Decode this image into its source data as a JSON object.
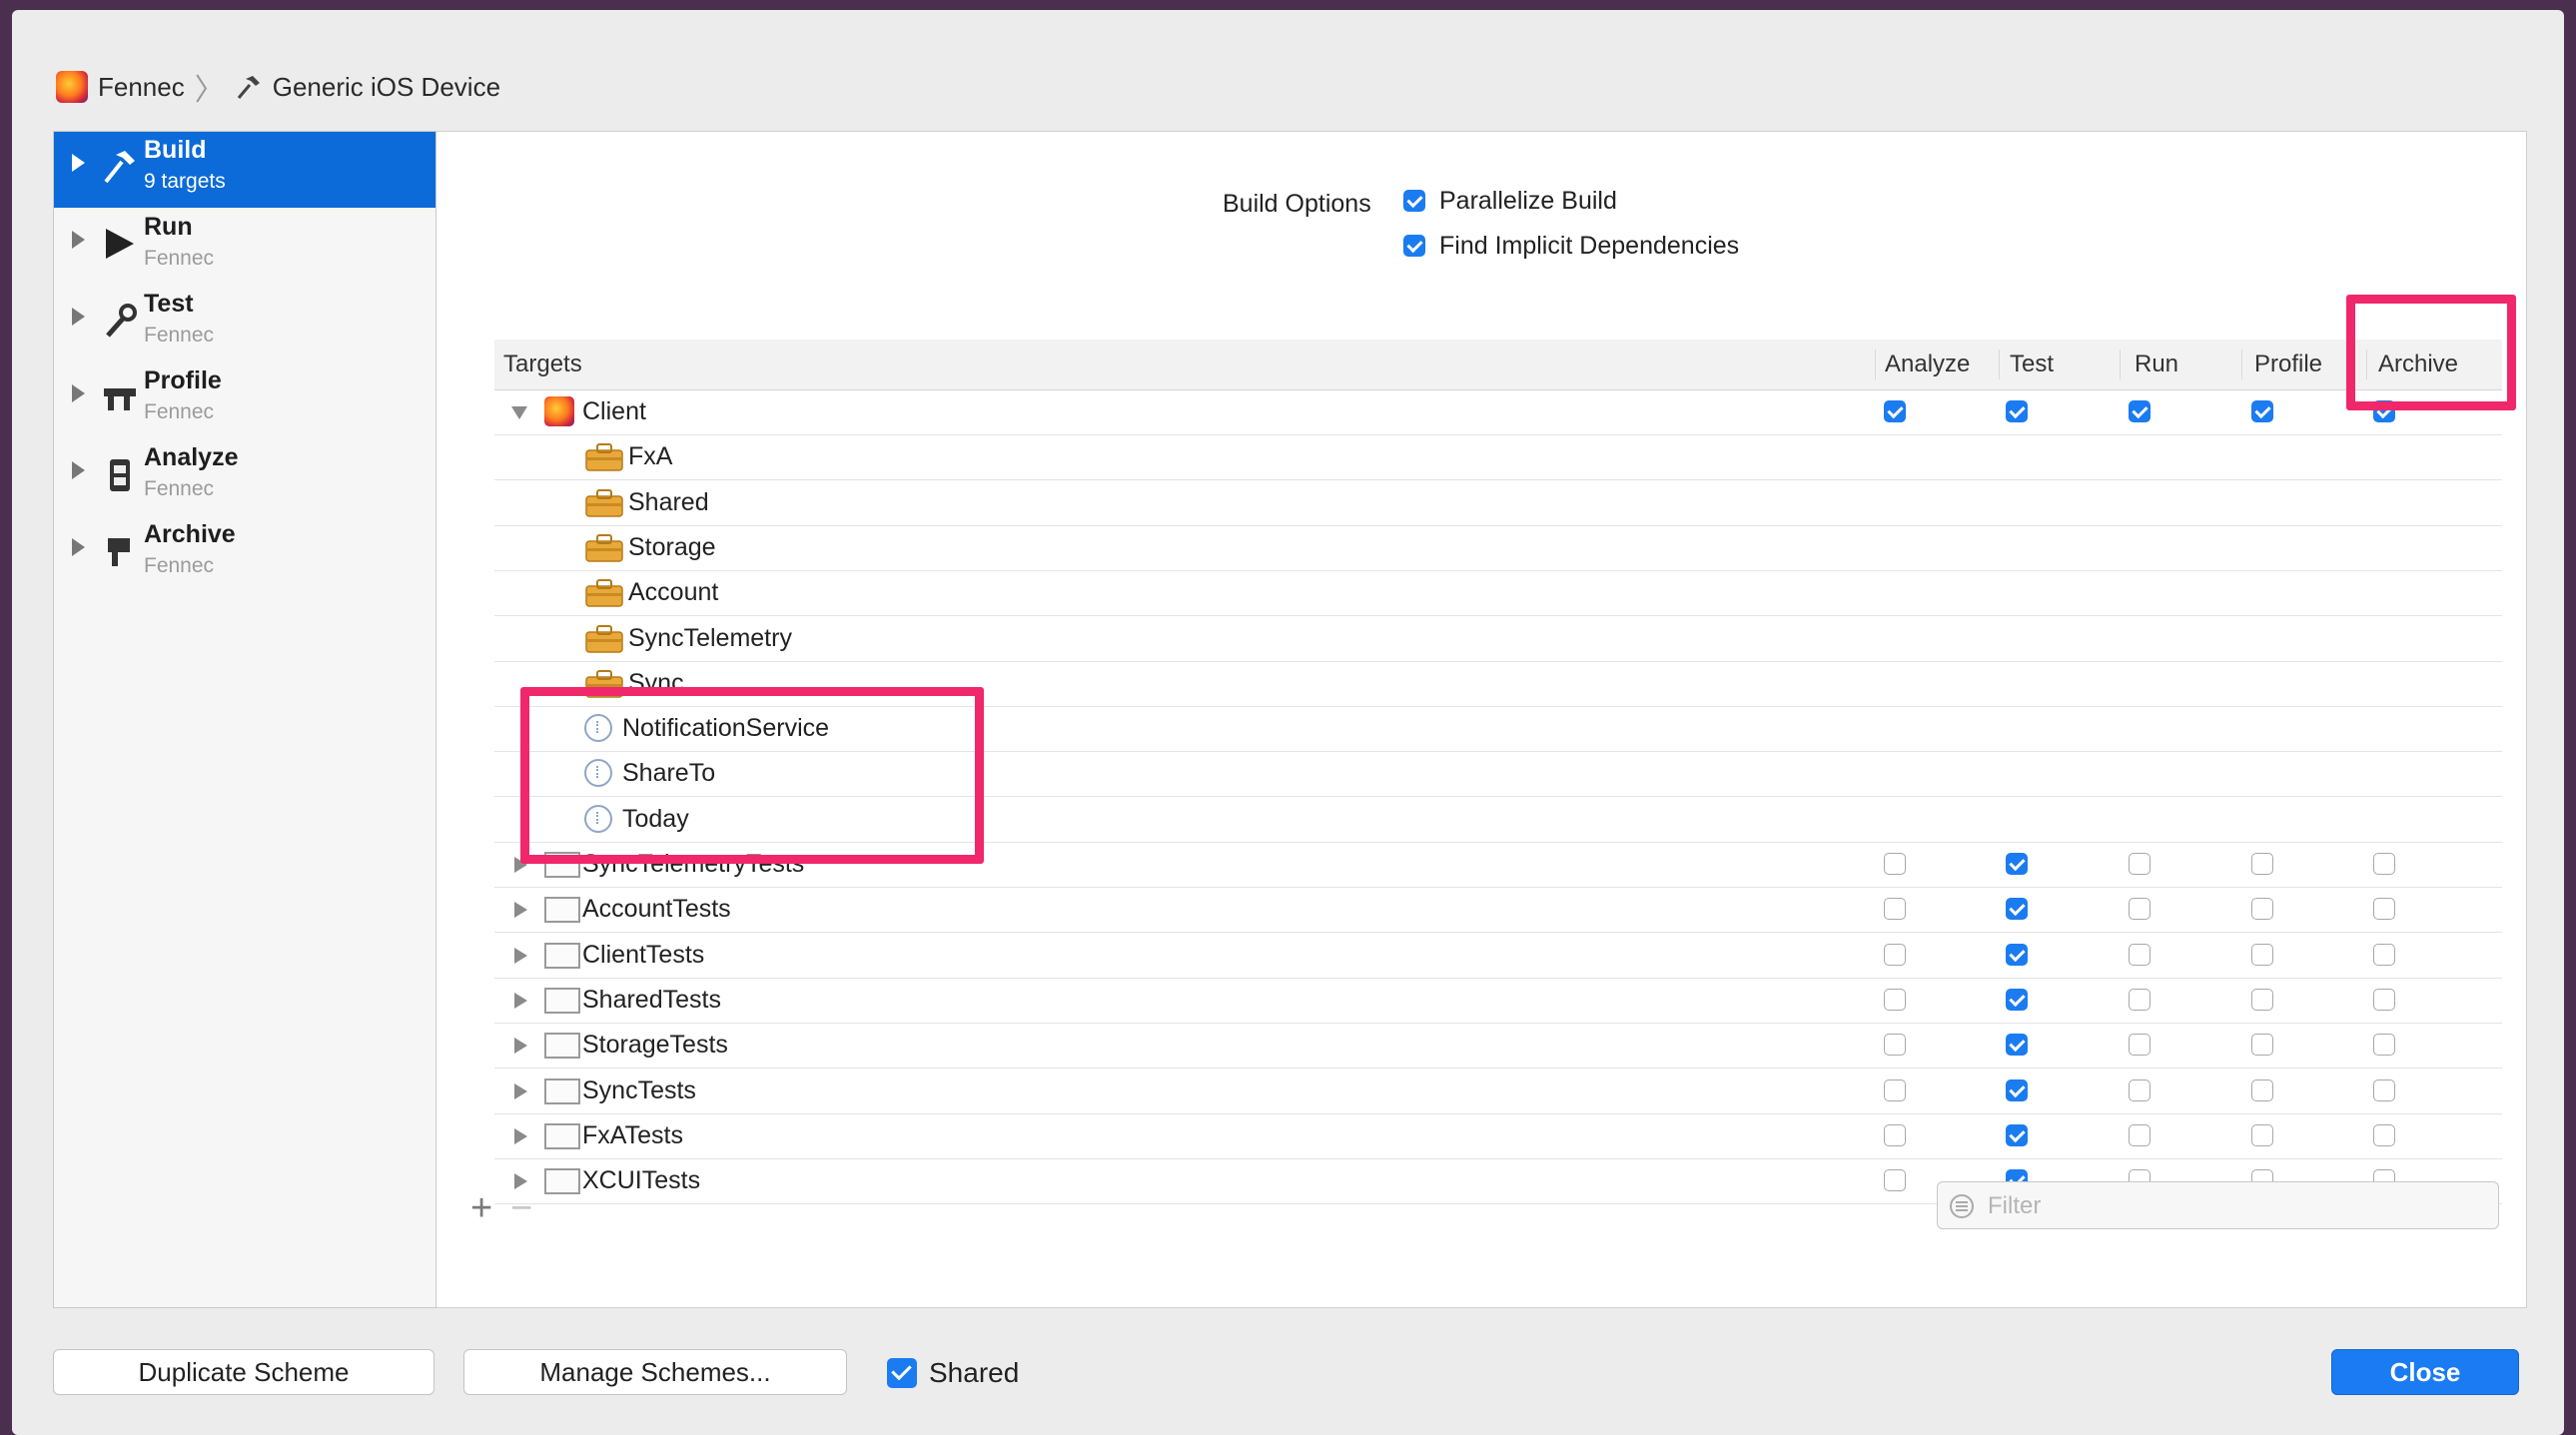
{
  "breadcrumb": {
    "scheme": "Fennec",
    "destination": "Generic iOS Device"
  },
  "sidebar": {
    "items": [
      {
        "title": "Build",
        "subtitle": "9 targets",
        "icon": "hammer-icon",
        "selected": true
      },
      {
        "title": "Run",
        "subtitle": "Fennec",
        "icon": "play-icon"
      },
      {
        "title": "Test",
        "subtitle": "Fennec",
        "icon": "wrench-icon"
      },
      {
        "title": "Profile",
        "subtitle": "Fennec",
        "icon": "gauge-icon"
      },
      {
        "title": "Analyze",
        "subtitle": "Fennec",
        "icon": "analyze-icon"
      },
      {
        "title": "Archive",
        "subtitle": "Fennec",
        "icon": "archive-icon"
      }
    ]
  },
  "build_options": {
    "label": "Build Options",
    "parallelize_label": "Parallelize Build",
    "parallelize_checked": true,
    "implicit_label": "Find Implicit Dependencies",
    "implicit_checked": true
  },
  "table": {
    "headers": {
      "targets": "Targets",
      "analyze": "Analyze",
      "test": "Test",
      "run": "Run",
      "profile": "Profile",
      "archive": "Archive"
    },
    "rows": [
      {
        "name": "Client",
        "icon": "firefox-app-icon",
        "level": 0,
        "expanded": true,
        "checks": [
          true,
          true,
          true,
          true,
          true
        ]
      },
      {
        "name": "FxA",
        "icon": "toolbox-icon",
        "level": 1
      },
      {
        "name": "Shared",
        "icon": "toolbox-icon",
        "level": 1
      },
      {
        "name": "Storage",
        "icon": "toolbox-icon",
        "level": 1
      },
      {
        "name": "Account",
        "icon": "toolbox-icon",
        "level": 1
      },
      {
        "name": "SyncTelemetry",
        "icon": "toolbox-icon",
        "level": 1
      },
      {
        "name": "Sync",
        "icon": "toolbox-icon",
        "level": 1
      },
      {
        "name": "NotificationService",
        "icon": "extension-icon",
        "level": 1
      },
      {
        "name": "ShareTo",
        "icon": "extension-icon",
        "level": 1
      },
      {
        "name": "Today",
        "icon": "extension-icon",
        "level": 1
      },
      {
        "name": "SyncTelemetryTests",
        "icon": "test-bundle-icon",
        "level": 0,
        "checks": [
          false,
          true,
          false,
          false,
          false
        ]
      },
      {
        "name": "AccountTests",
        "icon": "test-bundle-icon",
        "level": 0,
        "checks": [
          false,
          true,
          false,
          false,
          false
        ]
      },
      {
        "name": "ClientTests",
        "icon": "test-bundle-icon",
        "level": 0,
        "checks": [
          false,
          true,
          false,
          false,
          false
        ]
      },
      {
        "name": "SharedTests",
        "icon": "test-bundle-icon",
        "level": 0,
        "checks": [
          false,
          true,
          false,
          false,
          false
        ]
      },
      {
        "name": "StorageTests",
        "icon": "test-bundle-icon",
        "level": 0,
        "checks": [
          false,
          true,
          false,
          false,
          false
        ]
      },
      {
        "name": "SyncTests",
        "icon": "test-bundle-icon",
        "level": 0,
        "checks": [
          false,
          true,
          false,
          false,
          false
        ]
      },
      {
        "name": "FxATests",
        "icon": "test-bundle-icon",
        "level": 0,
        "checks": [
          false,
          true,
          false,
          false,
          false
        ]
      },
      {
        "name": "XCUITests",
        "icon": "test-bundle-icon",
        "level": 0,
        "checks": [
          false,
          true,
          false,
          false,
          false
        ]
      }
    ]
  },
  "footer": {
    "add_label": "+",
    "remove_label": "−",
    "filter_placeholder": "Filter",
    "duplicate_label": "Duplicate Scheme",
    "manage_label": "Manage Schemes...",
    "shared_label": "Shared",
    "shared_checked": true,
    "close_label": "Close"
  },
  "colors": {
    "accent": "#1a7bf2",
    "selection": "#0c6bd8",
    "highlight": "#f0276b",
    "desktop": "#4a2f4e"
  }
}
